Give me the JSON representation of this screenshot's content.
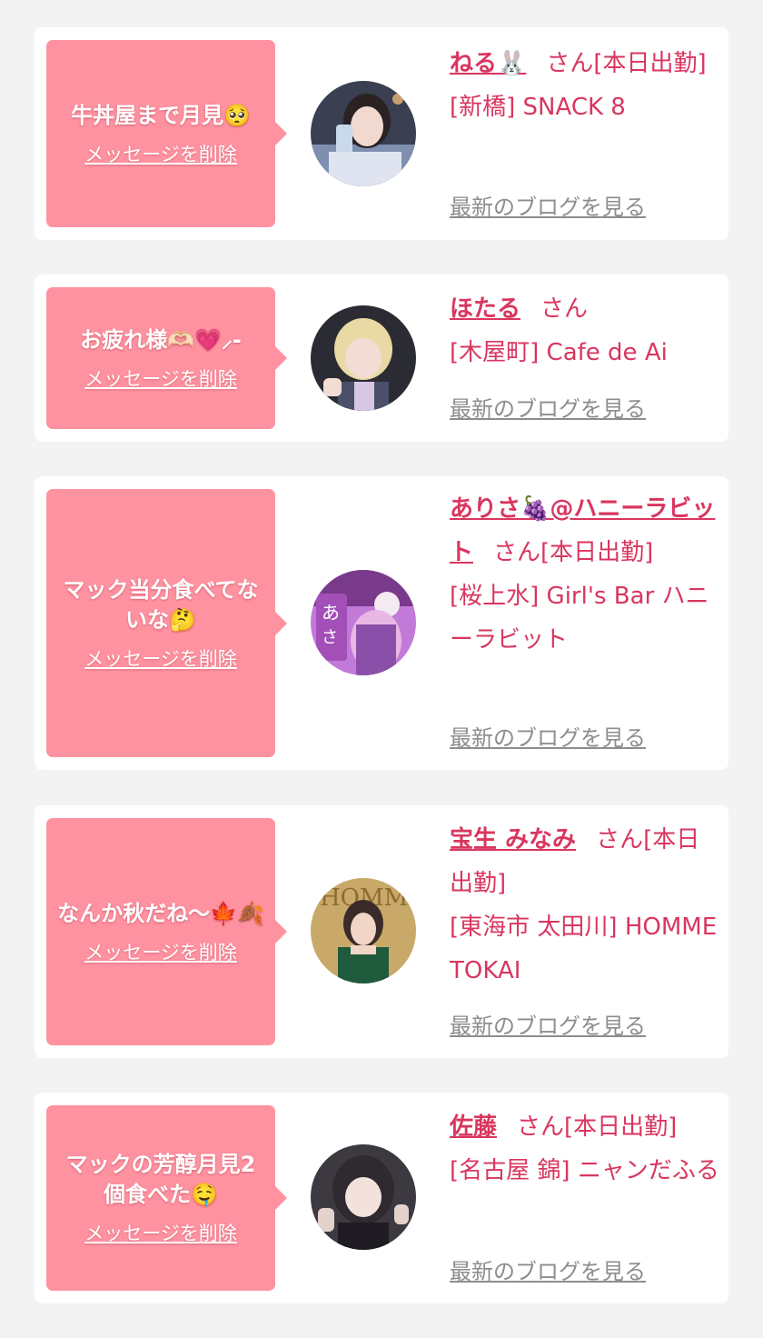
{
  "delete_label": "メッセージを削除",
  "blog_label": "最新のブログを見る",
  "honorific": "さん",
  "colors": {
    "bubble": "#ff92a0",
    "name": "#d9365f",
    "blog_link": "#8d8d8d",
    "background": "#f3f3f3"
  },
  "items": [
    {
      "message": "牛丼屋まで月見🥺",
      "name": "ねる🐰",
      "status": "[本日出勤]",
      "shop": "[新橋] SNACK 8",
      "avatar_icon": "woman-portrait-drink"
    },
    {
      "message": "お疲れ様🫶🏻💗⸝-",
      "name": "ほたる",
      "status": "",
      "shop": "[木屋町] Cafe de Ai",
      "avatar_icon": "blonde-portrait"
    },
    {
      "message": "マック当分食べてないな🤔",
      "name": "ありさ🍇@ハニーラビット",
      "status": "[本日出勤]",
      "shop": "[桜上水] Girl's Bar ハニーラビット",
      "avatar_icon": "purple-collage-portrait"
    },
    {
      "message": "なんか秋だね〜🍁🍂",
      "name": "宝生 みなみ",
      "status": "[本日出勤]",
      "shop": "[東海市 太田川] HOMME TOKAI",
      "avatar_icon": "gold-background-portrait"
    },
    {
      "message": "マックの芳醇月見2個食べた🤤",
      "name": "佐藤",
      "status": "[本日出勤]",
      "shop": "[名古屋 錦] ニャンだふる",
      "avatar_icon": "dark-hair-portrait"
    }
  ]
}
